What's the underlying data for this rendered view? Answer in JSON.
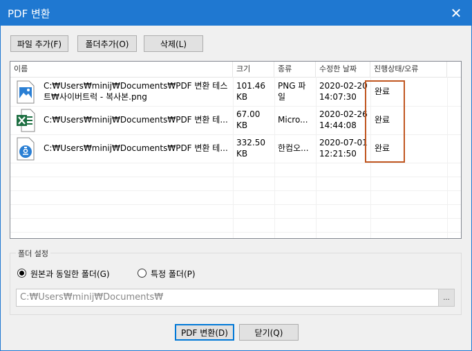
{
  "window": {
    "title": "PDF 변환",
    "close_glyph": "✕"
  },
  "toolbar": {
    "add_file": "파일 추가(F)",
    "add_folder": "폴더추가(O)",
    "delete": "삭제(L)"
  },
  "table": {
    "headers": [
      "이름",
      "크기",
      "종류",
      "수정한 날짜",
      "진행상태/오류"
    ],
    "rows": [
      {
        "icon": "image-file-icon",
        "name_line1": "C:₩Users₩minij₩Documents₩PDF 변환 테스",
        "name_line2": "트₩사이버트럭 - 복사본.png",
        "size_line1": "101.46",
        "size_line2": "KB",
        "type_line1": "PNG 파",
        "type_line2": "일",
        "date_line1": "2020-02-20",
        "date_line2": "14:07:30",
        "status": "완료"
      },
      {
        "icon": "excel-file-icon",
        "name_line1": "C:₩Users₩minij₩Documents₩PDF 변환 테...",
        "name_line2": "",
        "size_line1": "67.00",
        "size_line2": "KB",
        "type_line1": "Micro...",
        "type_line2": "",
        "date_line1": "2020-02-26",
        "date_line2": "14:44:08",
        "status": "완료"
      },
      {
        "icon": "hancom-file-icon",
        "name_line1": "C:₩Users₩minij₩Documents₩PDF 변환 테...",
        "name_line2": "",
        "size_line1": "332.50",
        "size_line2": "KB",
        "type_line1": "한컴오...",
        "type_line2": "",
        "date_line1": "2020-07-01",
        "date_line2": "12:21:50",
        "status": "완료"
      }
    ]
  },
  "folder_settings": {
    "title": "폴더 설정",
    "option_same": "원본과 동일한 폴더(G)",
    "option_specific": "특정 폴더(P)",
    "selected": "option_same",
    "path": "C:₩Users₩minij₩Documents₩",
    "browse": "..."
  },
  "footer": {
    "convert": "PDF 변환(D)",
    "close": "닫기(Q)"
  },
  "colors": {
    "titlebar": "#1f78d1",
    "highlight_border": "#c0551f",
    "excel_green": "#1d6f42",
    "hancom_blue": "#2a7fd4"
  }
}
